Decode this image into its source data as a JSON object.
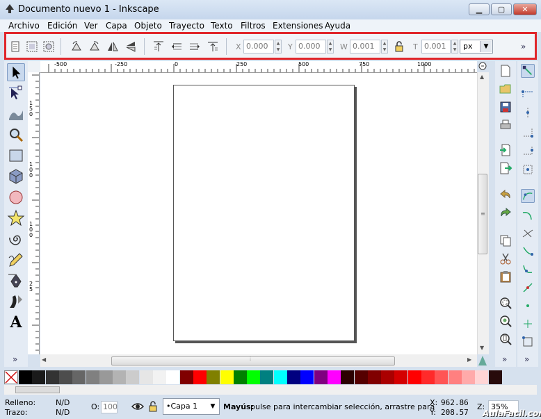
{
  "window": {
    "title": "Documento nuevo 1 - Inkscape"
  },
  "menu": [
    "Archivo",
    "Edición",
    "Ver",
    "Capa",
    "Objeto",
    "Trayecto",
    "Texto",
    "Filtros",
    "Extensiones",
    "Ayuda"
  ],
  "toolbar": {
    "x_label": "X",
    "x_value": "0.000",
    "y_label": "Y",
    "y_value": "0.000",
    "w_label": "W",
    "w_value": "0.001",
    "h_label": "T",
    "h_value": "0.001",
    "unit": "px",
    "overflow": "»"
  },
  "ruler": {
    "labels": [
      "-500",
      "-250",
      "0",
      "250",
      "500",
      "750",
      "1000"
    ],
    "v_labels": [
      "1",
      "5",
      "0",
      "1",
      "0",
      "0",
      "1",
      "0",
      "0",
      "2",
      "5"
    ]
  },
  "left_tools": [
    "selector",
    "node",
    "tweak",
    "zoom",
    "rectangle",
    "3d-box",
    "ellipse",
    "star",
    "spiral",
    "pencil",
    "pen",
    "calligraphy",
    "text"
  ],
  "left_tools_overflow": "»",
  "right_overflow": "»",
  "palette_colors": [
    "#000000",
    "#1a1a1a",
    "#333333",
    "#4d4d4d",
    "#666666",
    "#808080",
    "#999999",
    "#b3b3b3",
    "#cccccc",
    "#e6e6e6",
    "#f2f2f2",
    "#ffffff",
    "#800000",
    "#ff0000",
    "#808000",
    "#ffff00",
    "#008000",
    "#00ff00",
    "#008080",
    "#00ffff",
    "#000080",
    "#0000ff",
    "#800080",
    "#ff00ff",
    "#2b0000",
    "#550000",
    "#800000",
    "#aa0000",
    "#d40000",
    "#ff0000",
    "#ff2a2a",
    "#ff5555",
    "#ff8080",
    "#ffaaaa",
    "#ffd5d5",
    "#280b0b"
  ],
  "status": {
    "fill_label": "Relleno:",
    "fill_value": "N/D",
    "stroke_label": "Trazo:",
    "stroke_value": "N/D",
    "opacity_label": "O:",
    "opacity_value": "100",
    "layer": "•Capa 1",
    "message_bold": "Mayús:",
    "message": " pulse para intercambiar selección, arrastre para",
    "x_label": "X:",
    "x_value": "962.86",
    "y_label": "Y:",
    "y_value": "208.57",
    "zoom_label": "Z:",
    "zoom_value": "35%"
  },
  "watermark": "AulaFacil.com"
}
